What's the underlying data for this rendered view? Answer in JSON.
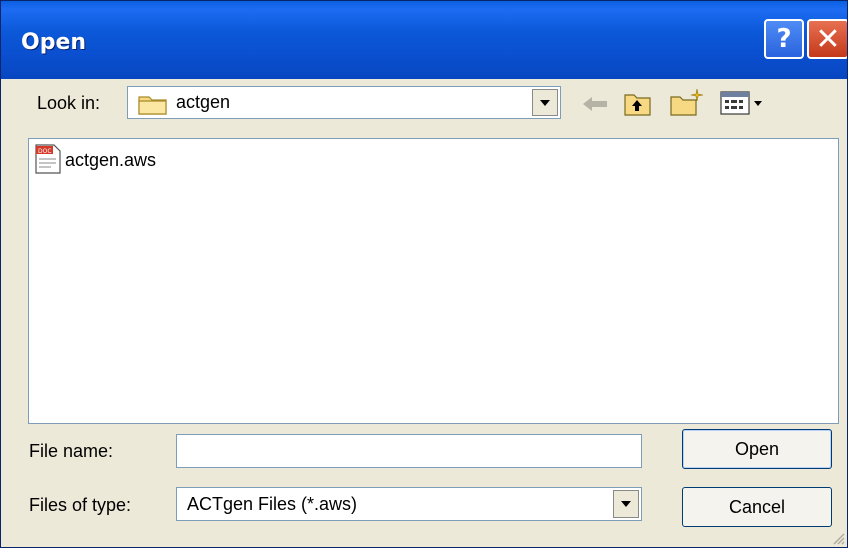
{
  "window": {
    "title": "Open",
    "help_label": "?",
    "close_label": "✕"
  },
  "lookin": {
    "label": "Look in:",
    "value": "actgen"
  },
  "files": [
    {
      "name": "actgen.aws",
      "icon": "doc-file-icon"
    }
  ],
  "filename": {
    "label": "File name:",
    "value": ""
  },
  "filetype": {
    "label": "Files of type:",
    "value": "ACTgen Files (*.aws)"
  },
  "buttons": {
    "open": "Open",
    "cancel": "Cancel"
  },
  "colors": {
    "titlebar": "#0a58d8",
    "dialog_bg": "#ece9d8",
    "close_red": "#c4391a"
  }
}
